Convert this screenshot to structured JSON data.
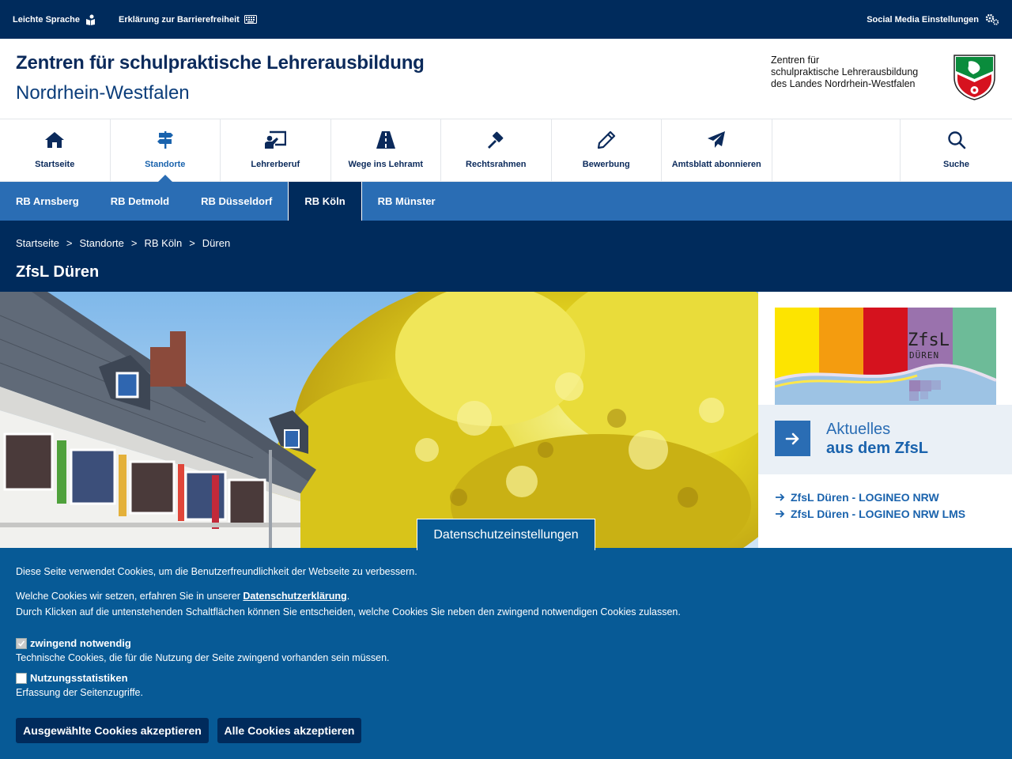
{
  "topbar": {
    "easy_language": "Leichte Sprache",
    "accessibility": "Erklärung zur Barrierefreiheit",
    "social_media": "Social Media Einstellungen"
  },
  "header": {
    "title_line1": "Zentren für schulpraktische Lehrerausbildung",
    "title_line2": "Nordrhein-Westfalen",
    "logo_line1": "Zentren für",
    "logo_line2": "schulpraktische Lehrerausbildung",
    "logo_line3": "des Landes Nordrhein-Westfalen"
  },
  "mainnav": [
    {
      "label": "Startseite",
      "icon": "home-icon"
    },
    {
      "label": "Standorte",
      "icon": "signpost-icon"
    },
    {
      "label": "Lehrerberuf",
      "icon": "teacher-board-icon"
    },
    {
      "label": "Wege ins Lehramt",
      "icon": "road-icon"
    },
    {
      "label": "Rechtsrahmen",
      "icon": "gavel-icon"
    },
    {
      "label": "Bewerbung",
      "icon": "pencil-icon"
    },
    {
      "label": "Amtsblatt abonnieren",
      "icon": "paper-plane-icon"
    },
    {
      "label": "Suche",
      "icon": "search-icon"
    }
  ],
  "subnav": [
    "RB Arnsberg",
    "RB Detmold",
    "RB Düsseldorf",
    "RB Köln",
    "RB Münster"
  ],
  "breadcrumb": [
    "Startseite",
    "Standorte",
    "RB Köln",
    "Düren"
  ],
  "breadcrumb_sep": ">",
  "page_title": "ZfsL Düren",
  "sidebar": {
    "logo_text1": "ZfsL",
    "logo_text2": "DÜREN",
    "news_line1": "Aktuelles",
    "news_line2": "aus dem ZfsL",
    "links": [
      "ZfsL Düren - LOGINEO NRW",
      "ZfsL Düren - LOGINEO NRW LMS"
    ]
  },
  "privacy_tab": "Datenschutzeinstellungen",
  "cookie": {
    "intro": "Diese Seite verwendet Cookies, um die Benutzerfreundlichkeit der Webseite zu verbessern.",
    "which_prefix": "Welche Cookies wir setzen, erfahren Sie in unserer ",
    "privacy_link": "Datenschutzerklärung",
    "which_suffix": ".",
    "choose": "Durch Klicken auf die untenstehenden Schaltflächen können Sie entscheiden, welche Cookies Sie neben den zwingend notwendigen Cookies zulassen.",
    "opt1_label": "zwingend notwendig",
    "opt1_desc": "Technische Cookies, die für die Nutzung der Seite zwingend vorhanden sein müssen.",
    "opt2_label": "Nutzungsstatistiken",
    "opt2_desc": "Erfassung der Seitenzugriffe.",
    "btn_selected": "Ausgewählte Cookies akzeptieren",
    "btn_all": "Alle Cookies akzeptieren"
  },
  "colors": {
    "navy": "#002b5c",
    "blue": "#2a6db4",
    "cookie_bg": "#075a96"
  }
}
